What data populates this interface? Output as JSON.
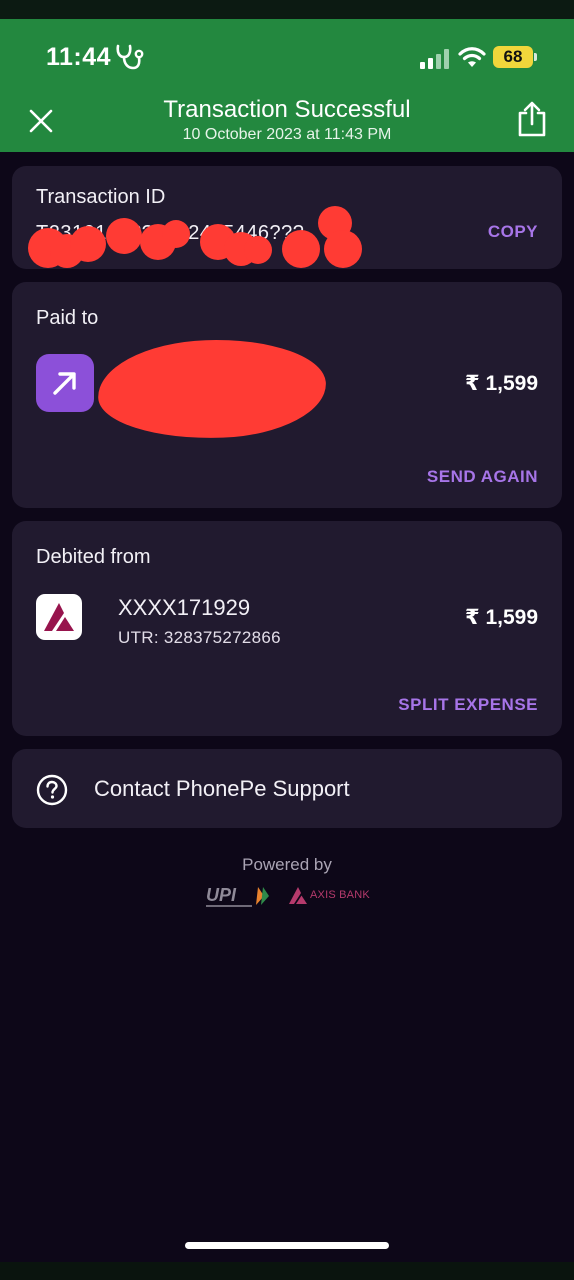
{
  "status_bar": {
    "time": "11:44",
    "battery": "68",
    "icons": [
      "stethoscope-icon",
      "signal-icon",
      "wifi-icon",
      "battery-icon"
    ]
  },
  "header": {
    "title": "Transaction Successful",
    "subtitle": "10 October 2023 at 11:43 PM",
    "close_icon": "close-icon",
    "share_icon": "share-icon"
  },
  "transaction": {
    "label": "Transaction ID",
    "value_visible": "T231010??????24?5446???",
    "copy_label": "COPY"
  },
  "paid_to": {
    "label": "Paid to",
    "amount": "₹ 1,599",
    "action_label": "SEND AGAIN",
    "icon": "arrow-up-right-icon"
  },
  "debited_from": {
    "label": "Debited from",
    "account": "XXXX171929",
    "utr": "UTR: 328375272866",
    "amount": "₹ 1,599",
    "action_label": "SPLIT EXPENSE",
    "icon": "axis-bank-logo"
  },
  "support": {
    "label": "Contact PhonePe Support",
    "icon": "help-circle-icon"
  },
  "footer": {
    "powered_by": "Powered by",
    "upi_logo_text": "UPI",
    "axis_logo_text": "AXIS BANK"
  },
  "colors": {
    "header_green": "#23883f",
    "background": "#0d0718",
    "card": "#211a2f",
    "accent_purple": "#a775e8",
    "redaction": "#ff3b34",
    "battery_yellow": "#f1d63b"
  }
}
